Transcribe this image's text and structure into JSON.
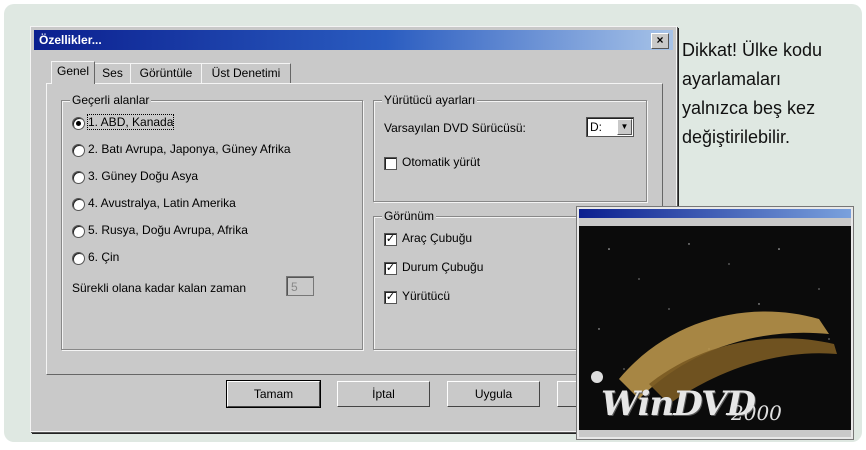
{
  "dialog": {
    "title": "Özellikler...",
    "close_glyph": "×",
    "tabs": [
      "Genel",
      "Ses",
      "Görüntüle",
      "Üst Denetimi"
    ],
    "region_group": {
      "title": "Geçerli alanlar",
      "options": [
        {
          "label": "1. ABD, Kanada",
          "selected": true
        },
        {
          "label": "2. Batı Avrupa, Japonya, Güney Afrika",
          "selected": false
        },
        {
          "label": "3. Güney Doğu Asya",
          "selected": false
        },
        {
          "label": "4. Avustralya, Latin Amerika",
          "selected": false
        },
        {
          "label": "5. Rusya, Doğu Avrupa, Afrika",
          "selected": false
        },
        {
          "label": "6. Çin",
          "selected": false
        }
      ],
      "remaining_label": "Sürekli olana kadar kalan zaman",
      "remaining_value": "5"
    },
    "player_group": {
      "title": "Yürütücü ayarları",
      "default_drive_label": "Varsayılan DVD Sürücüsü:",
      "default_drive_value": "D:",
      "autoplay_label": "Otomatik yürüt",
      "autoplay_checked": false
    },
    "view_group": {
      "title": "Görünüm",
      "items": [
        {
          "label": "Araç Çubuğu",
          "checked": true
        },
        {
          "label": "Durum Çubuğu",
          "checked": true
        },
        {
          "label": "Yürütücü",
          "checked": true
        }
      ]
    },
    "buttons": {
      "ok": "Tamam",
      "cancel": "İptal",
      "apply": "Uygula"
    }
  },
  "note": "Dikkat! Ülke kodu ayarlamaları yalnızca beş kez değiştirilebilir.",
  "windvd": {
    "logo": "WinDVD",
    "logo_version": "2000"
  }
}
